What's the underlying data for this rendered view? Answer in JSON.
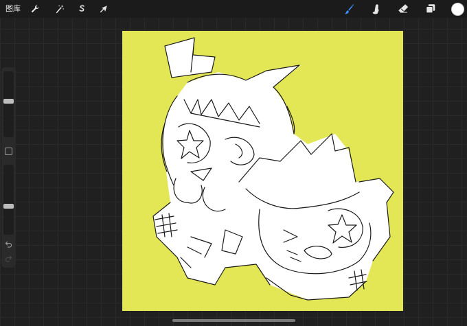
{
  "topbar": {
    "gallery_label": "图库",
    "left_tools": [
      {
        "name": "actions",
        "icon": "wrench-icon"
      },
      {
        "name": "adjustments",
        "icon": "magic-wand-icon"
      },
      {
        "name": "selection",
        "icon": "selection-s-icon"
      },
      {
        "name": "transform",
        "icon": "arrow-cursor-icon"
      }
    ],
    "right_tools": [
      {
        "name": "paint",
        "icon": "brush-icon",
        "active": true
      },
      {
        "name": "smudge",
        "icon": "smudge-finger-icon"
      },
      {
        "name": "erase",
        "icon": "eraser-icon"
      },
      {
        "name": "layers",
        "icon": "layers-icon"
      }
    ],
    "current_color": "#ffffff",
    "accent_color": "#3d8cf5"
  },
  "sidebar": {
    "brush_size_level": 0.55,
    "brush_opacity_level": 0.4
  },
  "canvas": {
    "background_color": "#e3e755",
    "stroke_color": "#1a1a1a",
    "fill_color": "#ffffff"
  }
}
